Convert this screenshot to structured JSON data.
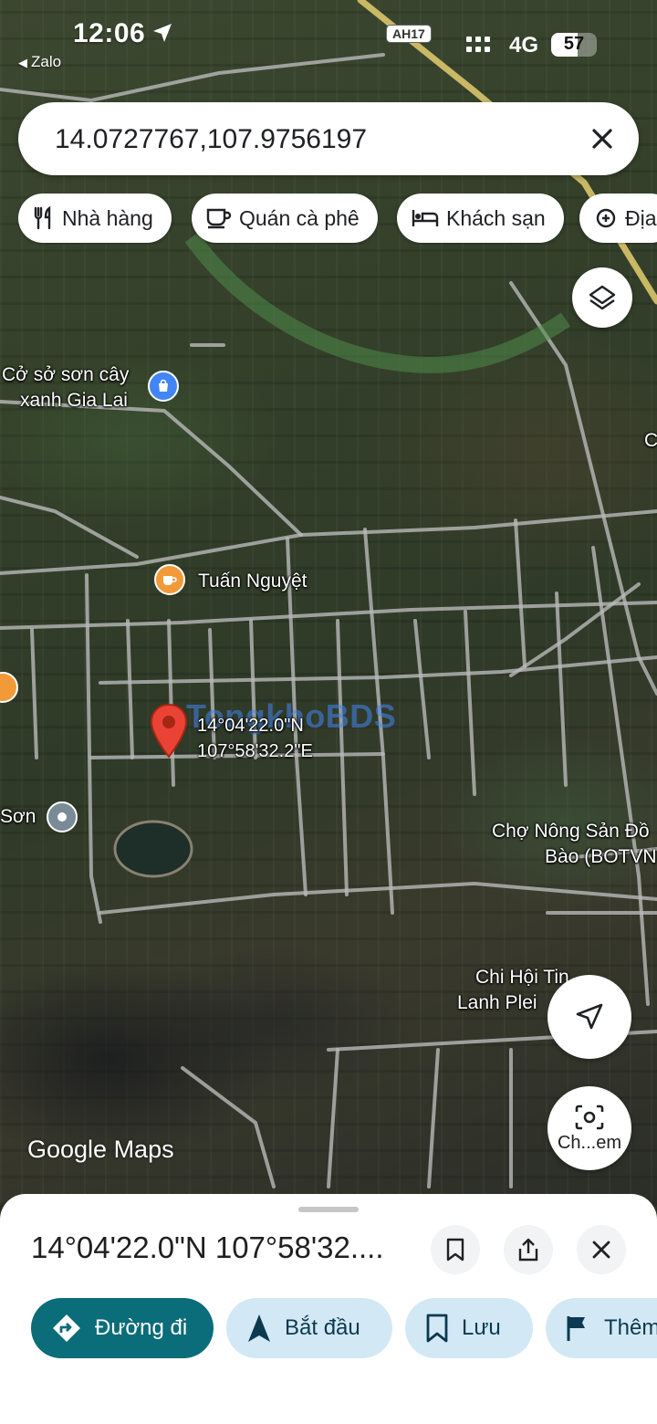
{
  "status_bar": {
    "time": "12:06",
    "back_app": "Zalo",
    "network": "4G",
    "battery_level": "57",
    "battery_fraction": 0.57
  },
  "map": {
    "route_badge": "AH17",
    "watermark": "TongkhoBDS",
    "attribution": "Google Maps",
    "pin_label_lat": "14°04'22.0\"N",
    "pin_label_lng": "107°58'32.2\"E",
    "places": {
      "co_so_son_cay_line1": "Cở sở sơn cây",
      "co_so_son_cay_line2": "xanh Gia Lai",
      "tuan_nguyet": "Tuấn Nguyệt",
      "son": "Sơn",
      "cho_nong_san_line1": "Chợ Nông Sản Đồ",
      "cho_nong_san_line2": "Bào (BOTVN",
      "chi_hoi_line1": "Chi Hội Tin",
      "chi_hoi_line2": "Lanh Plei",
      "edge_right": "C"
    },
    "camera_button_label": "Ch...em"
  },
  "search": {
    "value": "14.0727767,107.9756197"
  },
  "chips": [
    {
      "label": "Nhà hàng",
      "icon": "fork-knife-icon"
    },
    {
      "label": "Quán cà phê",
      "icon": "coffee-cup-icon"
    },
    {
      "label": "Khách sạn",
      "icon": "bed-icon"
    },
    {
      "label": "Địa",
      "icon": "landmark-icon"
    }
  ],
  "sheet": {
    "coordinates": "14°04'22.0\"N 107°58'32....",
    "actions": [
      {
        "label": "Đường đi",
        "icon": "directions-icon"
      },
      {
        "label": "Bắt đầu",
        "icon": "navigation-arrow-icon"
      },
      {
        "label": "Lưu",
        "icon": "bookmark-icon"
      },
      {
        "label": "Thêm",
        "icon": "flag-icon"
      }
    ]
  },
  "colors": {
    "primary_action": "#0b6c7a",
    "secondary_action": "#d3e8f5",
    "pin_red": "#ea4335",
    "poi_blue": "#4285f4",
    "poi_orange": "#f29a38",
    "poi_gray": "#7a8b95"
  }
}
